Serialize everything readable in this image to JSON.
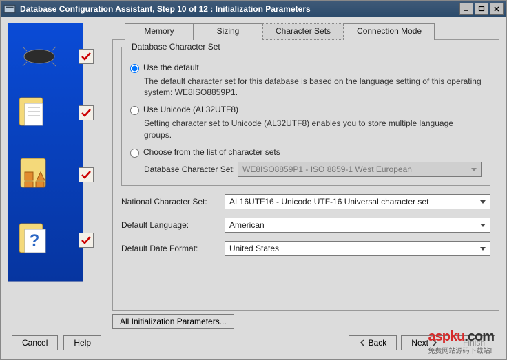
{
  "window": {
    "title": "Database Configuration Assistant, Step 10 of 12 : Initialization Parameters"
  },
  "tabs": {
    "memory": "Memory",
    "sizing": "Sizing",
    "charsets": "Character Sets",
    "connmode": "Connection Mode"
  },
  "group": {
    "title": "Database Character Set",
    "opt_default_label": "Use the default",
    "opt_default_desc": "The default character set for this database is based on the language setting of this operating system: WE8ISO8859P1.",
    "opt_unicode_label": "Use Unicode (AL32UTF8)",
    "opt_unicode_desc": "Setting character set to Unicode (AL32UTF8) enables you to store multiple language groups.",
    "opt_choose_label": "Choose from the list of character sets",
    "db_charset_label": "Database Character Set:",
    "db_charset_value": "WE8ISO8859P1 - ISO 8859-1 West European"
  },
  "fields": {
    "ncs_label": "National Character Set:",
    "ncs_value": "AL16UTF16 - Unicode UTF-16 Universal character set",
    "lang_label": "Default Language:",
    "lang_value": "American",
    "date_label": "Default Date Format:",
    "date_value": "United States"
  },
  "buttons": {
    "all_params": "All Initialization Parameters...",
    "cancel": "Cancel",
    "help": "Help",
    "back": "Back",
    "next": "Next",
    "finish": "Finish"
  },
  "watermark": {
    "main": "aspku",
    "dot": ".com",
    "sub": "免费网站源码下载站!"
  }
}
